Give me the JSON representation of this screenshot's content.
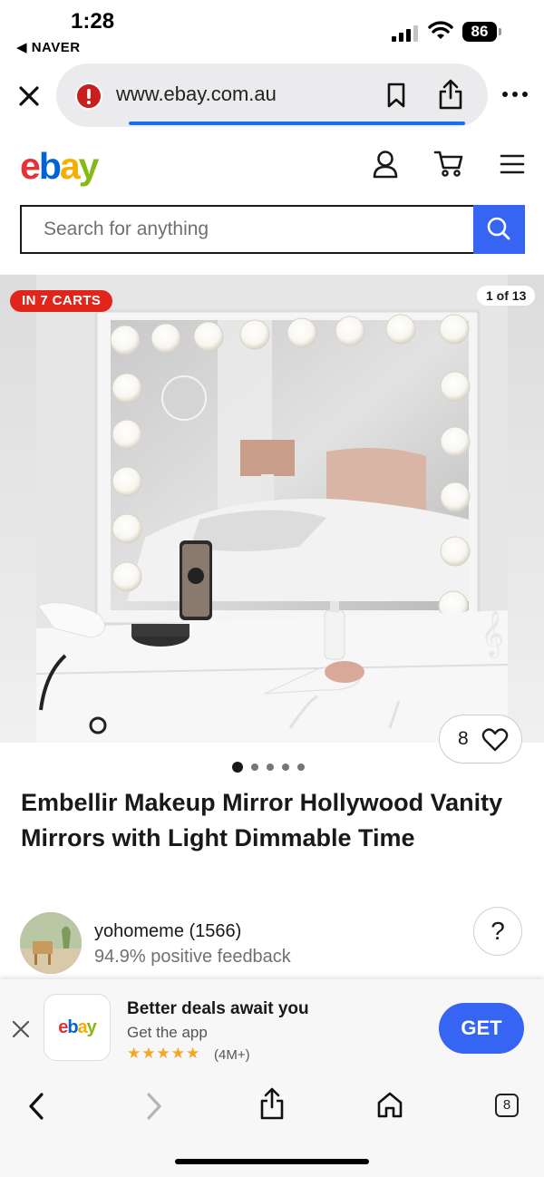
{
  "status_bar": {
    "time": "1:28",
    "back_label": "◀ NAVER",
    "battery": "86"
  },
  "browser": {
    "url": "www.ebay.com.au",
    "progress": 0.9
  },
  "header": {
    "logo_letters": [
      {
        "char": "e",
        "color": "#e53238"
      },
      {
        "char": "b",
        "color": "#0064d2"
      },
      {
        "char": "a",
        "color": "#f5af02"
      },
      {
        "char": "y",
        "color": "#86b817"
      }
    ]
  },
  "search": {
    "placeholder": "Search for anything",
    "accent": "#3665f3"
  },
  "gallery": {
    "cart_badge": "IN 7 CARTS",
    "image_counter": "1 of 13",
    "watch_count": "8",
    "dots_total": 5,
    "dots_active": 0
  },
  "product": {
    "title": "Embellir Makeup Mirror Hollywood Vanity Mirrors with Light Dimmable Time"
  },
  "seller": {
    "name": "yohomeme (1566)",
    "feedback": "94.9% positive feedback"
  },
  "help_button": "?",
  "app_banner": {
    "app_name": "ebay",
    "title": "Better deals await you",
    "subtitle": "Get the app",
    "stars": "★★★★★",
    "rating_count": "(4M+)",
    "cta": "GET"
  },
  "bottom_nav": {
    "tab_count": "8"
  }
}
